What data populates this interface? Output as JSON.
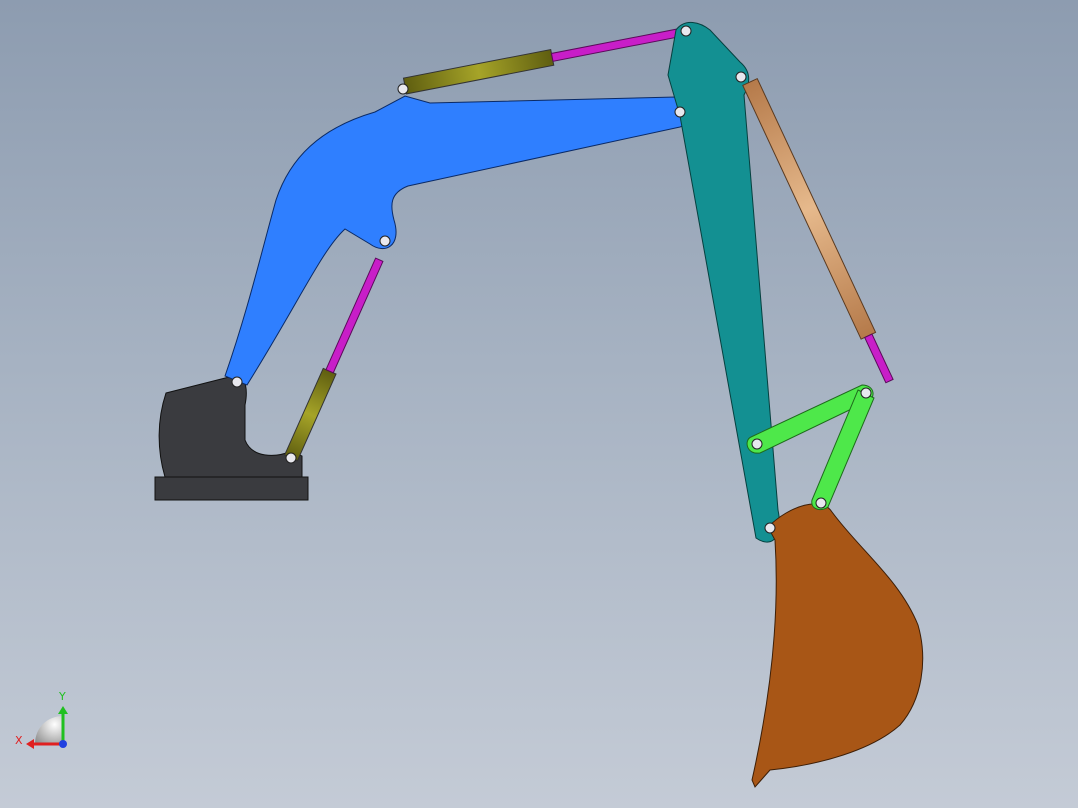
{
  "app": {
    "view": "3d-model-viewport"
  },
  "model": {
    "parts": [
      {
        "name": "base",
        "color": "#3a3b3f"
      },
      {
        "name": "boom",
        "color": "#2f7fff"
      },
      {
        "name": "stick",
        "color": "#139092"
      },
      {
        "name": "bucket",
        "color": "#a85616"
      },
      {
        "name": "bucket-link",
        "color": "#4ee84a"
      },
      {
        "name": "boom-cylinder",
        "color": "#87861a"
      },
      {
        "name": "stick-cylinder",
        "color": "#6a6b23"
      },
      {
        "name": "bucket-cylinder",
        "color": "#d49a6a"
      },
      {
        "name": "piston-rod",
        "color": "#c81ec8"
      }
    ]
  },
  "triad": {
    "x_label": "X",
    "y_label": "Y",
    "x_color": "#e02020",
    "y_color": "#20c020",
    "z_color": "#2040e0"
  }
}
